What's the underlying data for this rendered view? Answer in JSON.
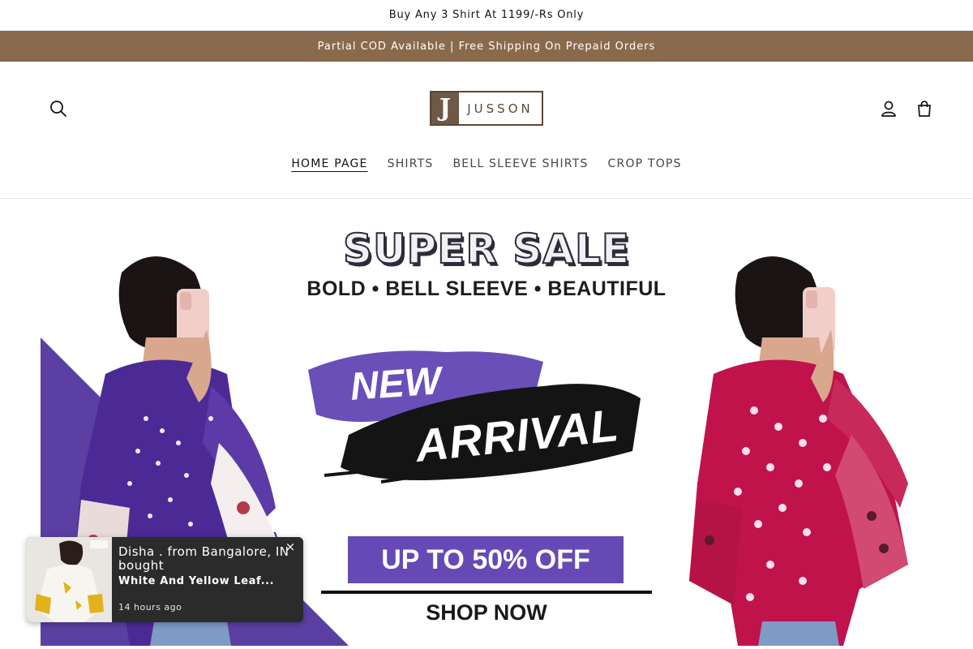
{
  "announcement": {
    "top": "Buy Any 3 Shirt At 1199/-Rs Only",
    "promo": "Partial COD Available | Free Shipping On Prepaid Orders"
  },
  "header": {
    "logo_mark": "J",
    "logo_text": "JUSSON",
    "icons": {
      "search": "search-icon",
      "account": "user-icon",
      "cart": "cart-icon"
    }
  },
  "nav": {
    "items": [
      {
        "label": "HOME PAGE"
      },
      {
        "label": "SHIRTS"
      },
      {
        "label": "BELL SLEEVE SHIRTS"
      },
      {
        "label": "CROP TOPS"
      }
    ]
  },
  "banner": {
    "headline": "SUPER SALE",
    "subheadline": "BOLD • BELL SLEEVE • BEAUTIFUL",
    "new": "NEW",
    "arrival": "ARRIVAL",
    "offer": "UP TO 50% OFF",
    "cta": "SHOP NOW",
    "colors": {
      "purple": "#5b3fa3",
      "offer": "#6749b5",
      "magenta": "#c0124b"
    }
  },
  "popup": {
    "title": "Disha . from Bangalore, IN bought",
    "product": "White And Yellow Leaf...",
    "time": "14 hours ago",
    "close": "×"
  },
  "colors": {
    "promo_bar": "#8a6a4c",
    "popup_bg": "#2b2b2b"
  }
}
